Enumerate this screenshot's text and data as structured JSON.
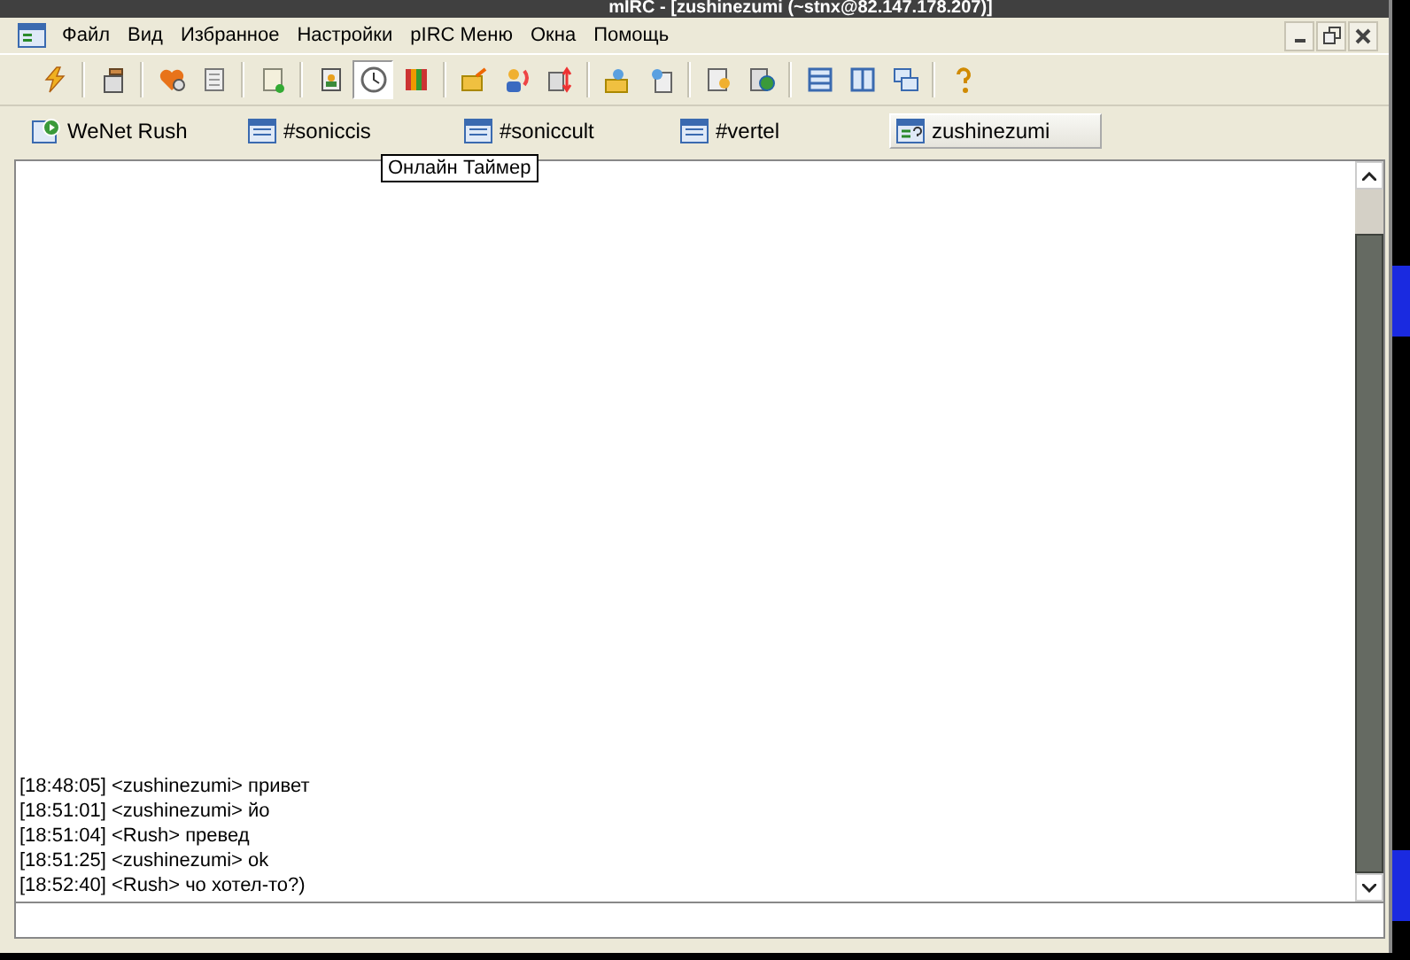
{
  "window": {
    "title": "mIRC - [zushinezumi (~stnx@82.147.178.207)]"
  },
  "menu": [
    "Файл",
    "Вид",
    "Избранное",
    "Настройки",
    "pIRC Меню",
    "Окна",
    "Помощь"
  ],
  "toolbar": [
    [
      {
        "pressed": false
      }
    ],
    [
      {
        "pressed": false
      }
    ],
    [
      {
        "pressed": false
      },
      {
        "pressed": false
      }
    ],
    [
      {
        "pressed": false
      }
    ],
    [
      {
        "pressed": false
      },
      {
        "pressed": true
      },
      {
        "pressed": false
      }
    ],
    [
      {
        "pressed": false
      },
      {
        "pressed": false
      },
      {
        "pressed": false
      }
    ],
    [
      {
        "pressed": false
      },
      {
        "pressed": false
      }
    ],
    [
      {
        "pressed": false
      },
      {
        "pressed": false
      }
    ],
    [
      {
        "pressed": false
      },
      {
        "pressed": false
      },
      {
        "pressed": false
      }
    ],
    [
      {
        "pressed": false
      }
    ]
  ],
  "switchbar": [
    {
      "kind": "status",
      "label": "WeNet Rush",
      "selected": false
    },
    {
      "kind": "channel",
      "label": "#soniccis",
      "selected": false
    },
    {
      "kind": "channel",
      "label": "#soniccult",
      "selected": false
    },
    {
      "kind": "channel",
      "label": "#vertel",
      "selected": false
    },
    {
      "kind": "query",
      "label": "zushinezumi",
      "selected": true
    }
  ],
  "tooltip": "Онлайн Таймер",
  "chat": [
    "[18:48:05] <zushinezumi> привет",
    "[18:51:01] <zushinezumi> йо",
    "[18:51:04] <Rush> превед",
    "[18:51:25] <zushinezumi> ok",
    "[18:52:40] <Rush> чо хотел-то?)"
  ]
}
